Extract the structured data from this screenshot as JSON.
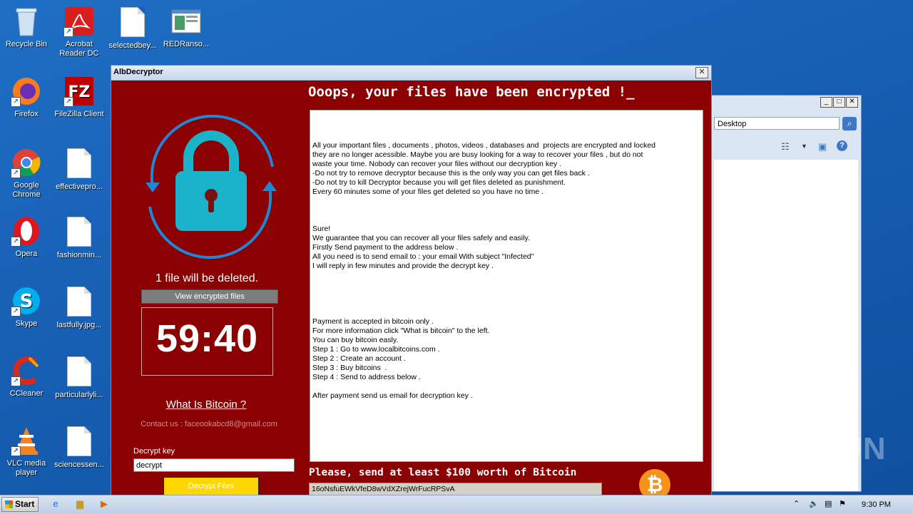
{
  "desktop": {
    "icons": [
      {
        "label": "Recycle Bin"
      },
      {
        "label": "Acrobat Reader DC"
      },
      {
        "label": "selectedbey..."
      },
      {
        "label": "REDRanso..."
      },
      {
        "label": "Firefox"
      },
      {
        "label": "FileZilla Client"
      },
      {
        "label": "Google Chrome"
      },
      {
        "label": "effectivepro..."
      },
      {
        "label": "Opera"
      },
      {
        "label": "fashionmin..."
      },
      {
        "label": "Skype"
      },
      {
        "label": "lastfully.jpg..."
      },
      {
        "label": "CCleaner"
      },
      {
        "label": "particularlyli..."
      },
      {
        "label": "VLC media player"
      },
      {
        "label": "sciencessen..."
      }
    ]
  },
  "explorer": {
    "address": "Desktop"
  },
  "window": {
    "title": "AlbDecryptor",
    "headline": "Ooops, your files have been encrypted !_",
    "message_lines": [
      "",
      "",
      "",
      "All your important files , documents , photos, videos , databases and  projects are encrypted and locked",
      "they are no longer acessible. Maybe you are busy looking for a way to recover your files , but do not",
      "waste your time. Nobody can recover your files without our decryption key .",
      "-Do not try to remove decryptor because this is the only way you can get files back .",
      "-Do not try to kill Decryptor because you will get files deleted as punishment.",
      "Every 60 minutes some of your files get deleted so you have no time .",
      "",
      "",
      "",
      "Sure!",
      "We guarantee that you can recover all your files safely and easily.",
      "Firstly Send payment to the address below .",
      "All you need is to send email to : your email With subject \"Infected\"",
      "I will reply in few minutes and provide the decrypt key .",
      "",
      "",
      "",
      "",
      "",
      "Payment is accepted in bitcoin only .",
      "For more information click \"What is bitcoin\" to the left.",
      "You can buy bitcoin easly.",
      "Step 1 : Go to www.localbitcoins.com .",
      "Step 2 : Create an account .",
      "Step 3 : Buy bitcoins  .",
      "Step 4 : Send to address below .",
      "",
      "After payment send us email for decryption key ."
    ],
    "payment_banner": "Please, send at least $100 worth of Bitcoin",
    "btc_address": "16oNsfuEWkVfeD8wVdXZrejWrFucRPSvA",
    "btc_symbol": "₿",
    "files_deleted_text": "1 file will be deleted.",
    "view_files_label": "View encrypted files",
    "timer": "59:40",
    "what_is_bitcoin": "What Is Bitcoin ?",
    "contact": "Contact us : faceookabcd8@gmail.com",
    "decrypt_key_label": "Decrypt key",
    "decrypt_key_value": "decrypt",
    "decrypt_button": "Decrypt Files"
  },
  "taskbar": {
    "start_label": "Start",
    "clock": "9:30 PM"
  },
  "watermark": "ANY RUN",
  "colors": {
    "window_bg": "#8b0000",
    "decrypt_button": "#ffd700",
    "bitcoin": "#f7931a",
    "lock_teal": "#1bb3c9"
  }
}
